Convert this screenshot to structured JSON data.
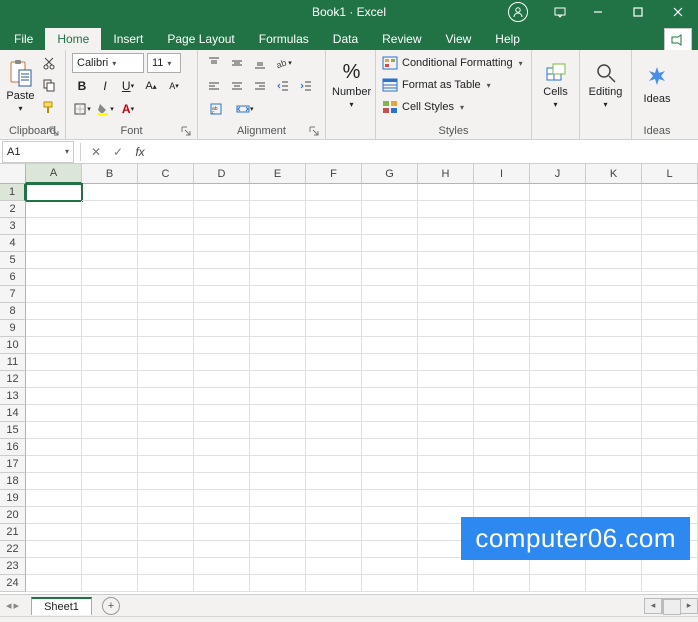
{
  "title": "Book1 · Excel",
  "tabs": [
    "File",
    "Home",
    "Insert",
    "Page Layout",
    "Formulas",
    "Data",
    "Review",
    "View",
    "Help"
  ],
  "active_tab": "Home",
  "ribbon": {
    "clipboard": {
      "label": "Clipboard",
      "paste": "Paste"
    },
    "font": {
      "label": "Font",
      "name": "Calibri",
      "size": "11"
    },
    "alignment": {
      "label": "Alignment"
    },
    "number": {
      "label": "Number",
      "symbol": "%"
    },
    "styles": {
      "label": "Styles",
      "cond_fmt": "Conditional Formatting",
      "fmt_table": "Format as Table",
      "cell_styles": "Cell Styles"
    },
    "cells": {
      "label": "Cells"
    },
    "editing": {
      "label": "Editing"
    },
    "ideas": {
      "label": "Ideas",
      "btn": "Ideas"
    }
  },
  "namebox": "A1",
  "formula": "",
  "columns": [
    "A",
    "B",
    "C",
    "D",
    "E",
    "F",
    "G",
    "H",
    "I",
    "J",
    "K",
    "L"
  ],
  "row_count": 24,
  "selected_cell": "A1",
  "sheet": {
    "name": "Sheet1"
  },
  "watermark": "computer06.com"
}
